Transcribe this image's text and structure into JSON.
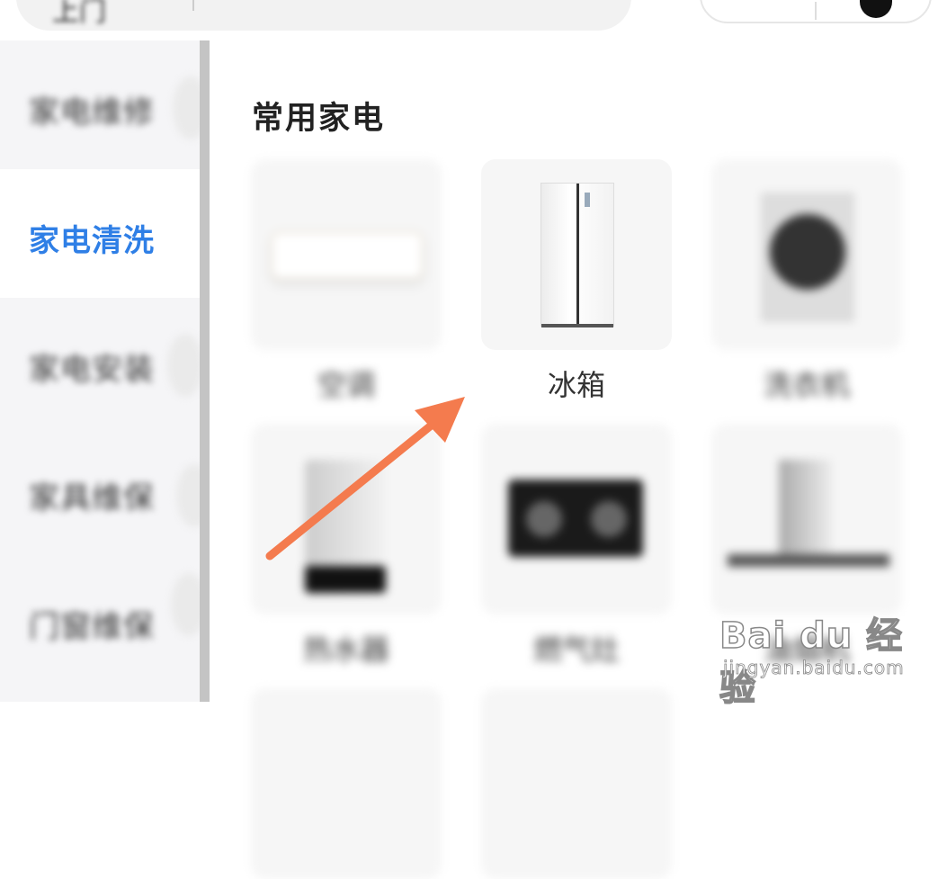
{
  "search": {
    "text": "上门"
  },
  "sidebar": {
    "items": [
      {
        "label": "家电维修",
        "active": false
      },
      {
        "label": "家电清洗",
        "active": true
      },
      {
        "label": "家电安装",
        "active": false
      },
      {
        "label": "家具维保",
        "active": false
      },
      {
        "label": "门窗维保",
        "active": false
      }
    ],
    "active_color": "#2f7fe6"
  },
  "main": {
    "section_title": "常用家电",
    "items": [
      {
        "label": "空调",
        "icon": "air-conditioner-icon"
      },
      {
        "label": "冰箱",
        "icon": "refrigerator-icon"
      },
      {
        "label": "洗衣机",
        "icon": "washing-machine-icon"
      },
      {
        "label": "热水器",
        "icon": "water-heater-icon"
      },
      {
        "label": "燃气灶",
        "icon": "gas-stove-icon"
      },
      {
        "label": "油烟机",
        "icon": "range-hood-icon"
      }
    ]
  },
  "annotation": {
    "arrow_color": "#f47b4e"
  },
  "watermark": {
    "main": "Bai du 经验",
    "sub": "jingyan.baidu.com"
  }
}
